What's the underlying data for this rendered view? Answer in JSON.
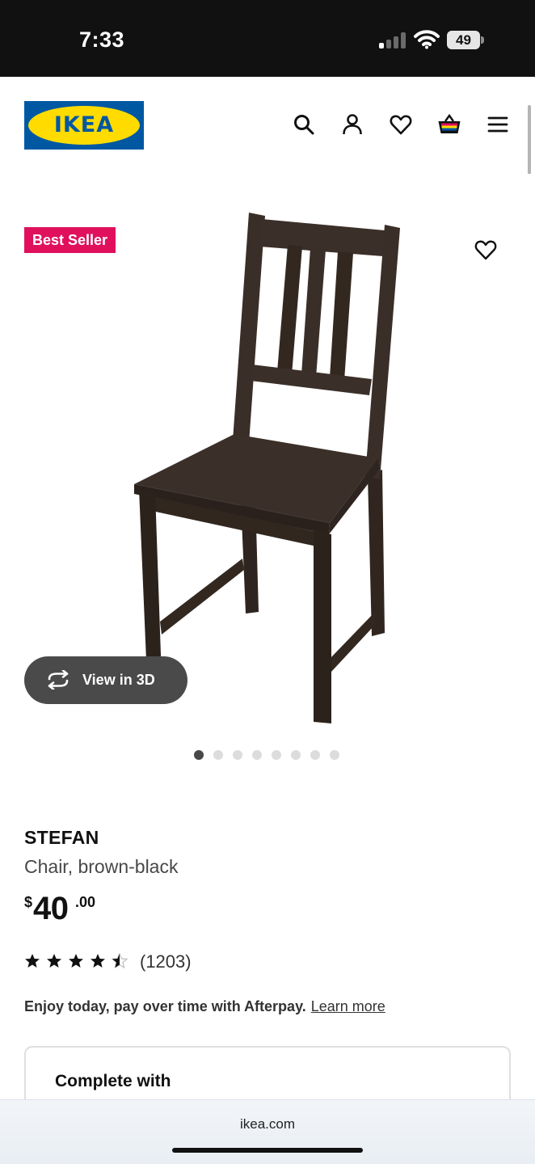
{
  "status_bar": {
    "time": "7:33",
    "battery": "49",
    "icons": [
      "signal-icon",
      "wifi-icon",
      "battery-icon"
    ]
  },
  "header": {
    "logo_text": "IKEA",
    "icons": [
      "search-icon",
      "account-icon",
      "heart-icon",
      "cart-icon",
      "menu-icon"
    ]
  },
  "gallery": {
    "badge": "Best Seller",
    "view_3d_label": "View in 3D",
    "image_count": 8,
    "active_index": 0
  },
  "product": {
    "name": "STEFAN",
    "description": "Chair, brown-black",
    "price": {
      "currency": "$",
      "integer": "40",
      "decimal": ".00"
    },
    "rating": {
      "value": 4.5,
      "max": 5,
      "count": "(1203)"
    },
    "afterpay_text": "Enjoy today, pay over time with Afterpay.",
    "afterpay_link": "Learn more"
  },
  "complete_with": {
    "title": "Complete with"
  },
  "browser": {
    "url": "ikea.com"
  },
  "colors": {
    "ikea_blue": "#0058a3",
    "ikea_yellow": "#ffdb00",
    "badge_pink": "#e0105d",
    "chair_brown": "#3a2e28"
  }
}
